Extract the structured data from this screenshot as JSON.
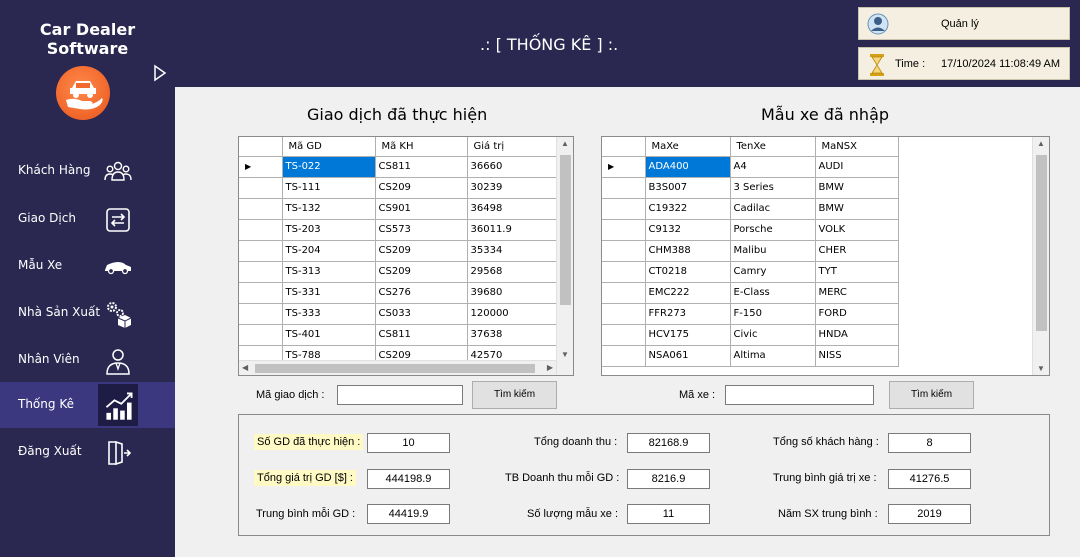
{
  "app": {
    "title": "Car Dealer Software"
  },
  "sidebar": {
    "items": [
      {
        "label": "Khách Hàng",
        "icon": "users-icon"
      },
      {
        "label": "Giao Dịch",
        "icon": "exchange-icon"
      },
      {
        "label": "Mẫu Xe",
        "icon": "car-icon"
      },
      {
        "label": "Nhà Sản Xuất",
        "icon": "factory-gears-icon"
      },
      {
        "label": "Nhân Viên",
        "icon": "employee-icon"
      },
      {
        "label": "Thống Kê",
        "icon": "bar-chart-icon",
        "active": true
      },
      {
        "label": "Đăng Xuất",
        "icon": "logout-icon"
      }
    ]
  },
  "header": {
    "title": ".: [ THỐNG KÊ ] :.",
    "user": "Quản lý",
    "time_label": "Time :",
    "time_value": "17/10/2024 11:08:49 AM"
  },
  "transactions": {
    "title": "Giao dịch đã thực hiện",
    "columns": [
      "Mã GD",
      "Mã KH",
      "Giá trị"
    ],
    "rows": [
      [
        "TS-022",
        "CS811",
        "36660"
      ],
      [
        "TS-111",
        "CS209",
        "30239"
      ],
      [
        "TS-132",
        "CS901",
        "36498"
      ],
      [
        "TS-203",
        "CS573",
        "36011.9"
      ],
      [
        "TS-204",
        "CS209",
        "35334"
      ],
      [
        "TS-313",
        "CS209",
        "29568"
      ],
      [
        "TS-331",
        "CS276",
        "39680"
      ],
      [
        "TS-333",
        "CS033",
        "120000"
      ],
      [
        "TS-401",
        "CS811",
        "37638"
      ],
      [
        "TS-788",
        "CS209",
        "42570"
      ]
    ],
    "search_label": "Mã giao dịch :",
    "search_value": "",
    "search_button": "Tìm kiếm"
  },
  "models": {
    "title": "Mẫu xe đã nhập",
    "columns": [
      "MaXe",
      "TenXe",
      "MaNSX"
    ],
    "rows": [
      [
        "ADA400",
        "A4",
        "AUDI"
      ],
      [
        "B3S007",
        "3 Series",
        "BMW"
      ],
      [
        "C19322",
        "Cadilac",
        "BMW"
      ],
      [
        "C9132",
        "Porsche",
        "VOLK"
      ],
      [
        "CHM388",
        "Malibu",
        "CHER"
      ],
      [
        "CT0218",
        "Camry",
        "TYT"
      ],
      [
        "EMC222",
        "E-Class",
        "MERC"
      ],
      [
        "FFR273",
        "F-150",
        "FORD"
      ],
      [
        "HCV175",
        "Civic",
        "HNDA"
      ],
      [
        "NSA061",
        "Altima",
        "NISS"
      ]
    ],
    "search_label": "Mã xe :",
    "search_value": "",
    "search_button": "Tìm kiếm"
  },
  "stats": {
    "so_gd_label": "Số GD đã thực hiện :",
    "so_gd": "10",
    "tong_gia_tri_label": "Tổng giá trị GD [$] :",
    "tong_gia_tri": "444198.9",
    "tb_moi_gd_label": "Trung bình mỗi GD :",
    "tb_moi_gd": "44419.9",
    "tong_doanh_thu_label": "Tổng doanh thu :",
    "tong_doanh_thu": "82168.9",
    "tb_doanh_thu_label": "TB Doanh thu mỗi GD :",
    "tb_doanh_thu": "8216.9",
    "so_luong_mau_label": "Số lượng mẫu xe :",
    "so_luong_mau": "11",
    "tong_kh_label": "Tổng số khách hàng :",
    "tong_kh": "8",
    "tb_gia_tri_xe_label": "Trung bình giá trị xe :",
    "tb_gia_tri_xe": "41276.5",
    "nam_sx_label": "Năm SX trung bình :",
    "nam_sx": "2019"
  },
  "colors": {
    "sidebar_bg": "#2a2750",
    "active_item": "#3b3880",
    "selection": "#0078d7",
    "highlight": "#fff9c4",
    "logo": "#f26a2e"
  }
}
